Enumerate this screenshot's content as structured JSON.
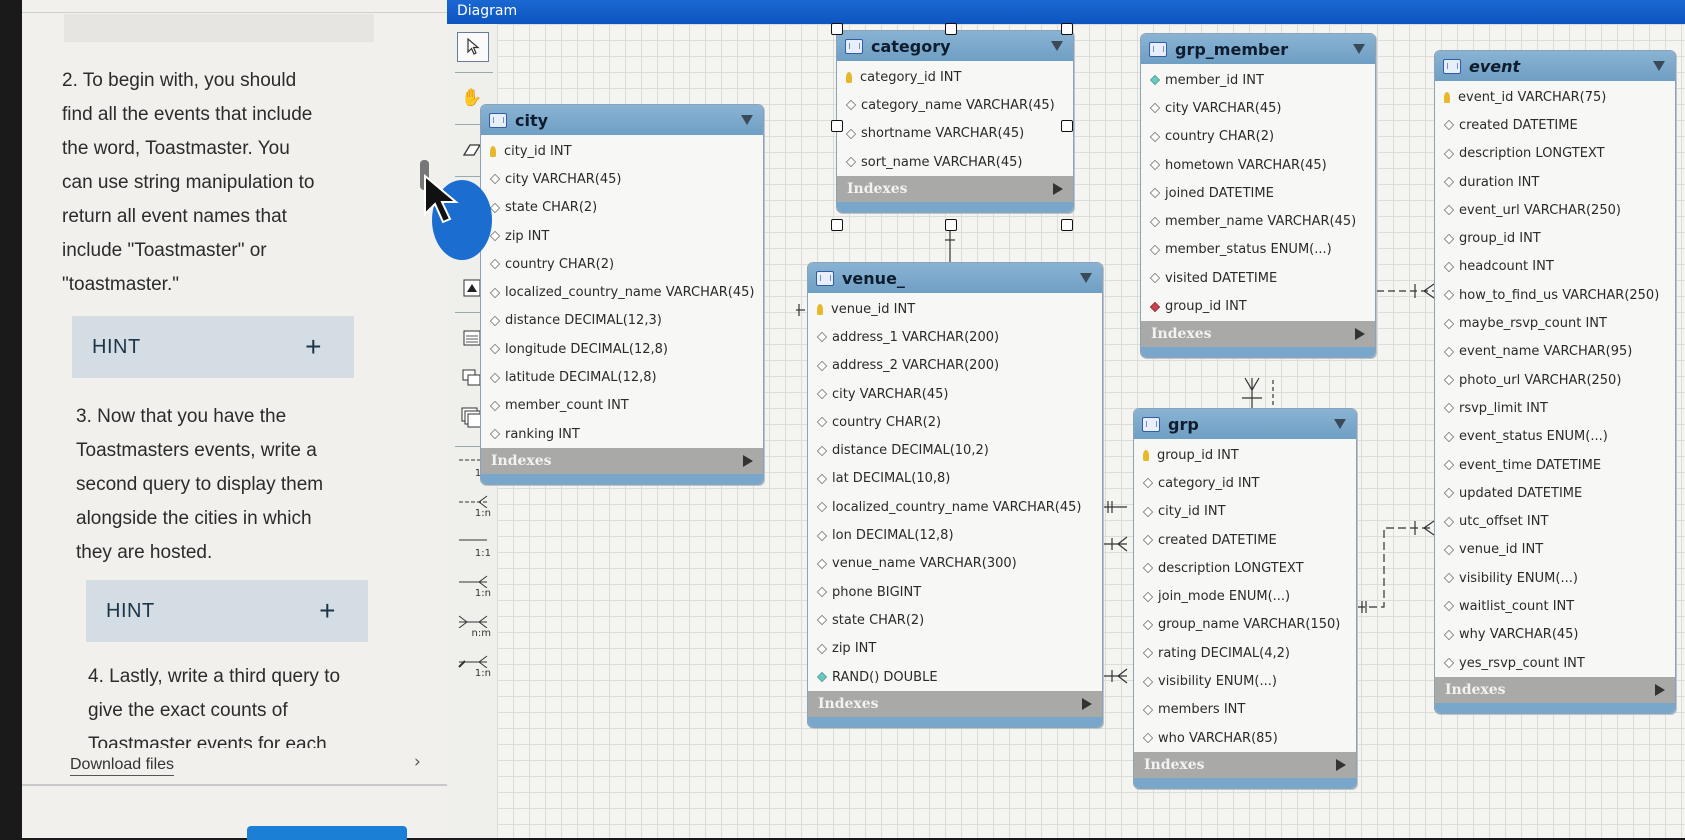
{
  "instructions": {
    "step2": [
      "2. To begin with, you should",
      "find all the events that include",
      "the word, Toastmaster. You",
      "can use string manipulation to",
      "return all event names that",
      "include \"Toastmaster\" or",
      "\"toastmaster.\""
    ],
    "step3": [
      "3. Now that you have the",
      "Toastmasters events, write a",
      "second query to display them",
      "alongside the cities in which",
      "they are hosted."
    ],
    "step4": [
      "4. Lastly, write a third query to",
      "give the exact counts of",
      "Toastmaster events for each"
    ],
    "hint_label": "HINT",
    "hint_toggle": "+",
    "download_label": "Download files",
    "download_chevron": "›"
  },
  "diagram": {
    "title": "Diagram",
    "indexes_label": "Indexes",
    "toolbar": {
      "tools": [
        "pointer-tool",
        "hand-tool",
        "eraser-tool",
        "layer-tool",
        "note-tool",
        "image-tool",
        "table-tool",
        "view-tool",
        "routine-group-tool"
      ],
      "relations": [
        "1:1",
        "1:n",
        "1:1",
        "1:n",
        "n:m",
        "1:n"
      ]
    },
    "tables": {
      "city": {
        "name": "city",
        "columns": [
          {
            "icon": "pk",
            "text": "city_id INT"
          },
          {
            "icon": "attr",
            "text": "city VARCHAR(45)"
          },
          {
            "icon": "attr",
            "text": "state CHAR(2)"
          },
          {
            "icon": "attr",
            "text": "zip INT"
          },
          {
            "icon": "attr",
            "text": "country CHAR(2)"
          },
          {
            "icon": "attr",
            "text": "localized_country_name VARCHAR(45)"
          },
          {
            "icon": "attr",
            "text": "distance DECIMAL(12,3)"
          },
          {
            "icon": "attr",
            "text": "longitude DECIMAL(12,8)"
          },
          {
            "icon": "attr",
            "text": "latitude DECIMAL(12,8)"
          },
          {
            "icon": "attr",
            "text": "member_count INT"
          },
          {
            "icon": "attr",
            "text": "ranking INT"
          }
        ]
      },
      "category": {
        "name": "category",
        "columns": [
          {
            "icon": "pk",
            "text": "category_id INT"
          },
          {
            "icon": "attr",
            "text": "category_name VARCHAR(45)"
          },
          {
            "icon": "attr",
            "text": "shortname VARCHAR(45)"
          },
          {
            "icon": "attr",
            "text": "sort_name VARCHAR(45)"
          }
        ]
      },
      "venue": {
        "name": "venue_",
        "columns": [
          {
            "icon": "pk",
            "text": "venue_id INT"
          },
          {
            "icon": "attr",
            "text": "address_1 VARCHAR(200)"
          },
          {
            "icon": "attr",
            "text": "address_2 VARCHAR(200)"
          },
          {
            "icon": "attr",
            "text": "city VARCHAR(45)"
          },
          {
            "icon": "attr",
            "text": "country CHAR(2)"
          },
          {
            "icon": "attr",
            "text": "distance DECIMAL(10,2)"
          },
          {
            "icon": "attr",
            "text": "lat DECIMAL(10,8)"
          },
          {
            "icon": "attr",
            "text": "localized_country_name VARCHAR(45)"
          },
          {
            "icon": "attr",
            "text": "lon DECIMAL(12,8)"
          },
          {
            "icon": "attr",
            "text": "venue_name VARCHAR(300)"
          },
          {
            "icon": "attr",
            "text": "phone BIGINT"
          },
          {
            "icon": "attr",
            "text": "state CHAR(2)"
          },
          {
            "icon": "attr",
            "text": "zip INT"
          },
          {
            "icon": "nn",
            "text": "RAND() DOUBLE"
          }
        ]
      },
      "grp_member": {
        "name": "grp_member",
        "columns": [
          {
            "icon": "nn",
            "text": "member_id INT"
          },
          {
            "icon": "attr",
            "text": "city VARCHAR(45)"
          },
          {
            "icon": "attr",
            "text": "country CHAR(2)"
          },
          {
            "icon": "attr",
            "text": "hometown VARCHAR(45)"
          },
          {
            "icon": "attr",
            "text": "joined DATETIME"
          },
          {
            "icon": "attr",
            "text": "member_name VARCHAR(45)"
          },
          {
            "icon": "attr",
            "text": "member_status ENUM(...)"
          },
          {
            "icon": "attr",
            "text": "visited DATETIME"
          },
          {
            "icon": "fk",
            "text": "group_id INT"
          }
        ]
      },
      "grp": {
        "name": "grp",
        "columns": [
          {
            "icon": "pk",
            "text": "group_id INT"
          },
          {
            "icon": "attr",
            "text": "category_id INT"
          },
          {
            "icon": "attr",
            "text": "city_id INT"
          },
          {
            "icon": "attr",
            "text": "created DATETIME"
          },
          {
            "icon": "attr",
            "text": "description LONGTEXT"
          },
          {
            "icon": "attr",
            "text": "join_mode ENUM(...)"
          },
          {
            "icon": "attr",
            "text": "group_name VARCHAR(150)"
          },
          {
            "icon": "attr",
            "text": "rating DECIMAL(4,2)"
          },
          {
            "icon": "attr",
            "text": "visibility ENUM(...)"
          },
          {
            "icon": "attr",
            "text": "members INT"
          },
          {
            "icon": "attr",
            "text": "who VARCHAR(85)"
          }
        ]
      },
      "event": {
        "name": "event",
        "columns": [
          {
            "icon": "pk",
            "text": "event_id VARCHAR(75)"
          },
          {
            "icon": "attr",
            "text": "created DATETIME"
          },
          {
            "icon": "attr",
            "text": "description LONGTEXT"
          },
          {
            "icon": "attr",
            "text": "duration INT"
          },
          {
            "icon": "attr",
            "text": "event_url VARCHAR(250)"
          },
          {
            "icon": "attr",
            "text": "group_id INT"
          },
          {
            "icon": "attr",
            "text": "headcount INT"
          },
          {
            "icon": "attr",
            "text": "how_to_find_us VARCHAR(250)"
          },
          {
            "icon": "attr",
            "text": "maybe_rsvp_count INT"
          },
          {
            "icon": "attr",
            "text": "event_name VARCHAR(95)"
          },
          {
            "icon": "attr",
            "text": "photo_url VARCHAR(250)"
          },
          {
            "icon": "attr",
            "text": "rsvp_limit INT"
          },
          {
            "icon": "attr",
            "text": "event_status ENUM(...)"
          },
          {
            "icon": "attr",
            "text": "event_time DATETIME"
          },
          {
            "icon": "attr",
            "text": "updated DATETIME"
          },
          {
            "icon": "attr",
            "text": "utc_offset INT"
          },
          {
            "icon": "attr",
            "text": "venue_id INT"
          },
          {
            "icon": "attr",
            "text": "visibility ENUM(...)"
          },
          {
            "icon": "attr",
            "text": "waitlist_count INT"
          },
          {
            "icon": "attr",
            "text": "why VARCHAR(45)"
          },
          {
            "icon": "attr",
            "text": "yes_rsvp_count INT"
          }
        ]
      }
    }
  }
}
